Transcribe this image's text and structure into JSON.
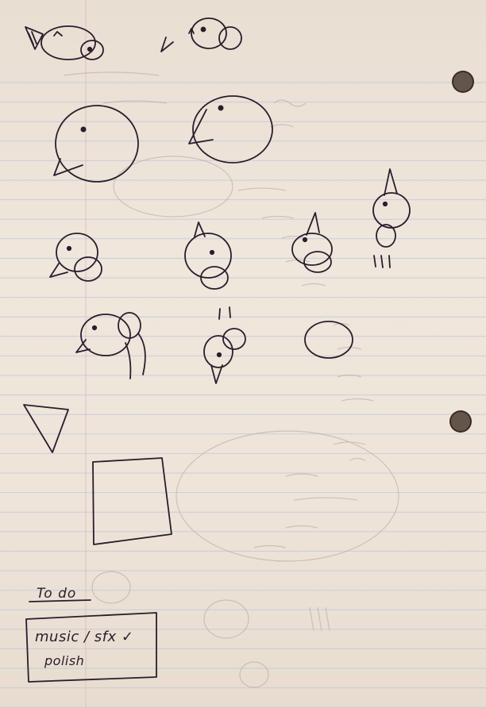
{
  "paper": {
    "background": "#eee4da",
    "rule_color": "#b6c6da",
    "margin_color": "#e3aeb6",
    "ink_color": "#2a1d2c",
    "ghost_color": "#b2a59c"
  },
  "sketches": [
    {
      "icon": "bird-sketch-icon",
      "description": "small round bird facing left with beak and eye"
    },
    {
      "icon": "bird-sketch-icon",
      "description": "small bird with beak pointing down-left"
    },
    {
      "icon": "bird-sketch-icon",
      "description": "large round bird facing left"
    },
    {
      "icon": "bird-sketch-icon",
      "description": "large round bird facing left with open beak"
    },
    {
      "icon": "bird-sketch-icon",
      "description": "small bird sitting"
    },
    {
      "icon": "bird-sketch-icon",
      "description": "bird with beak pointing up"
    },
    {
      "icon": "bird-sketch-icon",
      "description": "bird with beak up and belly"
    },
    {
      "icon": "bird-sketch-icon",
      "description": "tall bird with legs"
    },
    {
      "icon": "bird-sketch-icon",
      "description": "bird with wings and tail"
    },
    {
      "icon": "bird-sketch-icon",
      "description": "upside-down bird with feet up"
    },
    {
      "icon": "oval-sketch-icon",
      "description": "oval"
    },
    {
      "icon": "triangle-sketch-icon",
      "description": "triangle"
    },
    {
      "icon": "square-sketch-icon",
      "description": "square"
    }
  ],
  "todo": {
    "title": "To do",
    "items": [
      "music / sfx ✓",
      "polish"
    ]
  }
}
